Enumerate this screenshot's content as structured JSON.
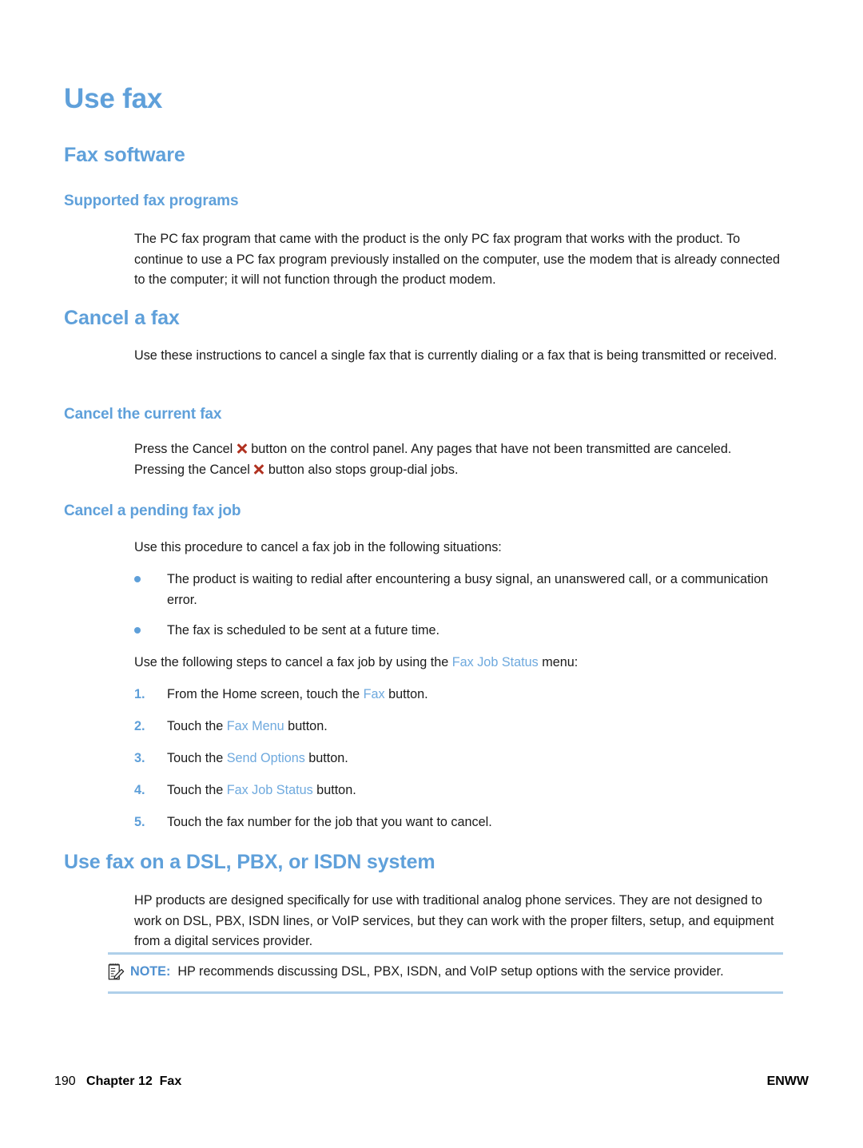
{
  "page": {
    "title": "Use fax"
  },
  "sections": {
    "fax_software": {
      "heading": "Fax software",
      "subheading": "Supported fax programs",
      "body": "The PC fax program that came with the product is the only PC fax program that works with the product. To continue to use a PC fax program previously installed on the computer, use the modem that is already connected to the computer; it will not function through the product modem."
    },
    "cancel_a_fax": {
      "heading": "Cancel a fax",
      "body": "Use these instructions to cancel a single fax that is currently dialing or a fax that is being transmitted or received.",
      "current_fax": {
        "subheading": "Cancel the current fax",
        "text_part_1": "Press the Cancel",
        "text_part_2": "button on the control panel. Any pages that have not been transmitted are canceled. Pressing the Cancel",
        "text_part_3": "button also stops group-dial jobs.",
        "icon": "cancel-x-icon",
        "icon_color": "#B13322"
      },
      "pending_fax_job": {
        "subheading": "Cancel a pending fax job",
        "intro": "Use this procedure to cancel a fax job in the following situations:",
        "bullets": [
          "The product is waiting to redial after encountering a busy signal, an unanswered call, or a communication error.",
          "The fax is scheduled to be sent at a future time."
        ],
        "steps_intro_before": "Use the following steps to cancel a fax job by using the ",
        "steps_intro_ui": "Fax Job Status",
        "steps_intro_after": " menu:",
        "steps": [
          {
            "number": "1.",
            "before": "From the Home screen, touch the ",
            "ui": "Fax",
            "after": " button."
          },
          {
            "number": "2.",
            "before": "Touch the ",
            "ui": "Fax Menu",
            "after": " button."
          },
          {
            "number": "3.",
            "before": "Touch the ",
            "ui": "Send Options",
            "after": " button."
          },
          {
            "number": "4.",
            "before": "Touch the ",
            "ui": "Fax Job Status",
            "after": " button."
          },
          {
            "number": "5.",
            "before": "Touch the fax number for the job that you want to cancel.",
            "ui": "",
            "after": ""
          }
        ]
      }
    },
    "dsl_pbx_isdn": {
      "heading": "Use fax on a DSL, PBX, or ISDN system",
      "body": "HP products are designed specifically for use with traditional analog phone services. They are not designed to work on DSL, PBX, ISDN lines, or VoIP services, but they can work with the proper filters, setup, and equipment from a digital services provider.",
      "note": {
        "icon": "note-pencil-icon",
        "label": "NOTE:",
        "text": "HP recommends discussing DSL, PBX, ISDN, and VoIP setup options with the service provider."
      }
    }
  },
  "footer": {
    "page_number": "190",
    "chapter": "Chapter 12",
    "chapter_title": "Fax",
    "locale": "ENWW"
  },
  "colors": {
    "heading_blue": "#5FA0DA",
    "ui_term_blue": "#6EA9DE",
    "note_rule_blue": "#AFD0EA",
    "cancel_red": "#B13322"
  }
}
